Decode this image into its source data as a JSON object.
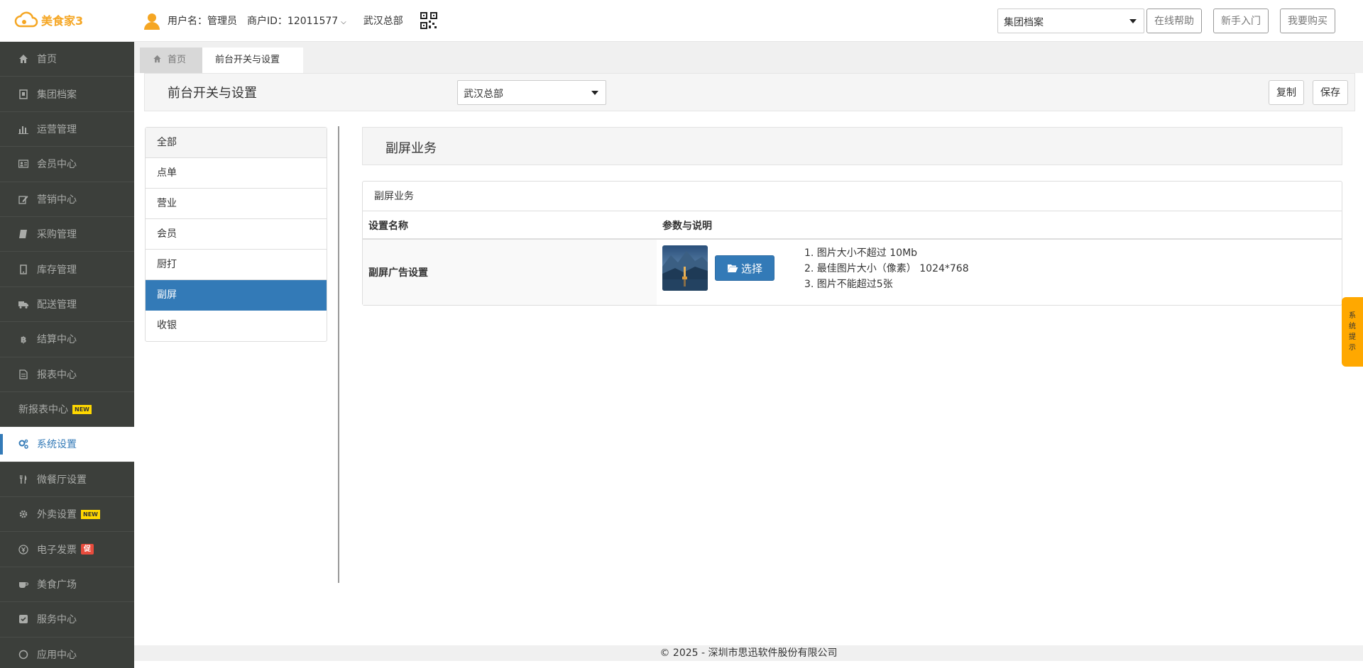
{
  "header": {
    "logo": "美食家3",
    "user_label": "用户名：管理员",
    "merchant_label": "商户ID：12011577",
    "store_name": "武汉总部",
    "group_select": "集团档案",
    "btn_help": "在线帮助",
    "btn_beginner": "新手入门",
    "btn_buy": "我要购买"
  },
  "sidebar": {
    "items": [
      {
        "label": "首页",
        "icon": "home-icon"
      },
      {
        "label": "集团档案",
        "icon": "file-icon"
      },
      {
        "label": "运营管理",
        "icon": "bar-chart-icon"
      },
      {
        "label": "会员中心",
        "icon": "id-card-icon"
      },
      {
        "label": "营销中心",
        "icon": "edit-icon"
      },
      {
        "label": "采购管理",
        "icon": "book-icon"
      },
      {
        "label": "库存管理",
        "icon": "tablet-icon"
      },
      {
        "label": "配送管理",
        "icon": "truck-icon"
      },
      {
        "label": "结算中心",
        "icon": "bitcoin-icon"
      },
      {
        "label": "报表中心",
        "icon": "report-icon"
      },
      {
        "label": "新报表中心",
        "badge": "NEW"
      },
      {
        "label": "系统设置",
        "icon": "cogs-icon"
      },
      {
        "label": "微餐厅设置",
        "icon": "cutlery-icon"
      },
      {
        "label": "外卖设置",
        "icon": "gear-icon",
        "badge": "NEW"
      },
      {
        "label": "电子发票",
        "icon": "invoice-icon",
        "badge": "促"
      },
      {
        "label": "美食广场",
        "icon": "coffee-icon"
      },
      {
        "label": "服务中心",
        "icon": "check-square-icon"
      },
      {
        "label": "应用中心",
        "icon": "app-icon"
      }
    ]
  },
  "tabs": {
    "home": "首页",
    "current": "前台开关与设置"
  },
  "page": {
    "title": "前台开关与设置",
    "store_select": "武汉总部",
    "btn_copy": "复制",
    "btn_save": "保存"
  },
  "categories": [
    "全部",
    "点单",
    "营业",
    "会员",
    "厨打",
    "副屏",
    "收银"
  ],
  "section": {
    "title": "副屏业务",
    "panel_title": "副屏业务",
    "col_name": "设置名称",
    "col_params": "参数与说明",
    "row_name": "副屏广告设置",
    "choose_btn": "选择",
    "notes": [
      "1. 图片大小不超过 10Mb",
      "2. 最佳图片大小（像素） 1024*768",
      "3. 图片不能超过5张"
    ]
  },
  "footer": "© 2025 - 深圳市思迅软件股份有限公司",
  "side_tip": [
    "系",
    "统",
    "提",
    "示"
  ],
  "colors": {
    "sidebar_bg": "#3c3f3b",
    "primary": "#337ab7",
    "logo": "#f5a623",
    "tip": "#ffa800"
  }
}
